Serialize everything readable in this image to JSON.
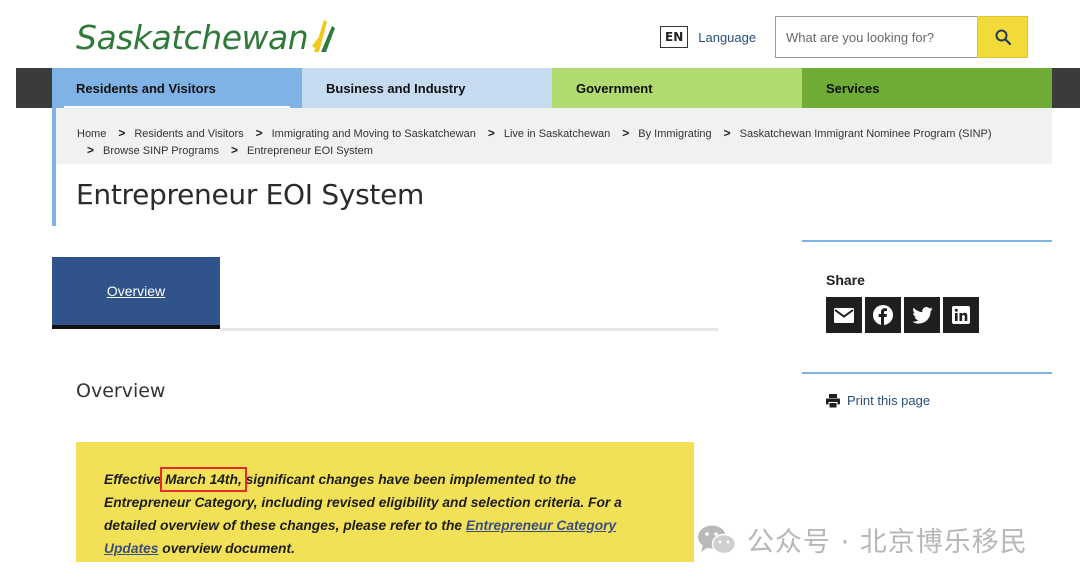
{
  "header": {
    "logo_text": "Saskatchewan",
    "language_code": "EN",
    "language_label": "Language",
    "search_placeholder": "What are you looking for?"
  },
  "nav": {
    "items": [
      {
        "label": "Residents and Visitors",
        "active": true
      },
      {
        "label": "Business and Industry"
      },
      {
        "label": "Government"
      },
      {
        "label": "Services"
      }
    ]
  },
  "breadcrumb": [
    "Home",
    "Residents and Visitors",
    "Immigrating and Moving to Saskatchewan",
    "Live in Saskatchewan",
    "By Immigrating",
    "Saskatchewan Immigrant Nominee Program (SINP)",
    "Browse SINP Programs",
    "Entrepreneur EOI System"
  ],
  "page": {
    "title": "Entrepreneur EOI System",
    "tab_label": "Overview",
    "section_heading": "Overview"
  },
  "notice": {
    "prefix": "Effective ",
    "date": "March 14th,",
    "middle": " significant changes have been implemented to the Entrepreneur Category, including revised eligibility and selection criteria. For a detailed overview of these changes, please refer to the ",
    "link": "Entrepreneur Category Updates",
    "suffix": " overview document."
  },
  "sidebar": {
    "share_label": "Share",
    "share_icons": [
      "email-icon",
      "facebook-icon",
      "twitter-icon",
      "linkedin-icon"
    ],
    "print_label": "Print this page"
  },
  "watermark": {
    "text": "公众号 · 北京博乐移民"
  },
  "colors": {
    "brand_green": "#2f7a3a",
    "search_yellow": "#f2da3a",
    "nav_residents": "#7fb2e5",
    "nav_business": "#c6dbef",
    "nav_government": "#b1da71",
    "nav_services": "#6eac35",
    "tab_blue": "#30538b",
    "notice_yellow": "#f2e157",
    "highlight_red": "#e32b2b"
  }
}
